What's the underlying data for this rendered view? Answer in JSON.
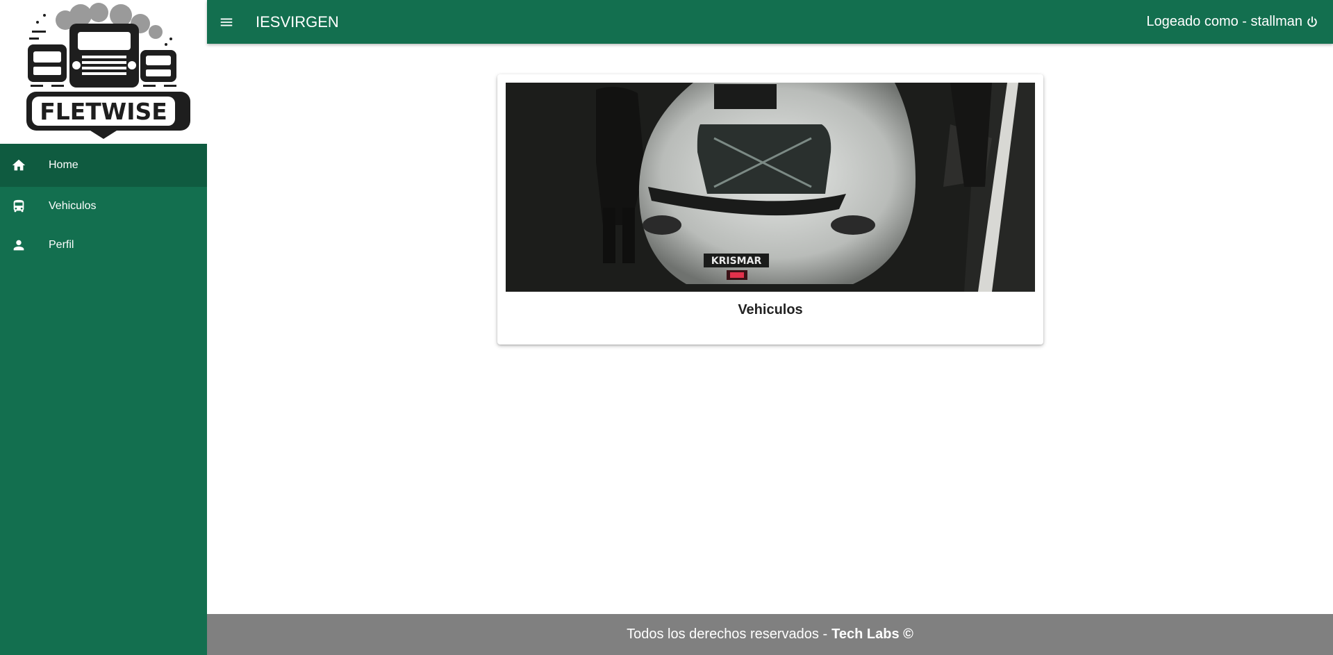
{
  "brand": {
    "logo_text": "FLETWISE"
  },
  "header": {
    "title": "IESVIRGEN",
    "user_label": "Logeado como - stallman"
  },
  "sidebar": {
    "items": [
      {
        "label": "Home",
        "icon": "home-icon"
      },
      {
        "label": "Vehiculos",
        "icon": "bus-icon"
      },
      {
        "label": "Perfil",
        "icon": "person-icon"
      }
    ]
  },
  "main": {
    "card": {
      "title": "Vehiculos",
      "plate_text": "KRISMAR"
    }
  },
  "footer": {
    "text": "Todos los derechos reservados -",
    "company": "Tech Labs ©"
  },
  "colors": {
    "primary": "#136f4f",
    "active": "#0f5b40",
    "footer": "#808080"
  }
}
